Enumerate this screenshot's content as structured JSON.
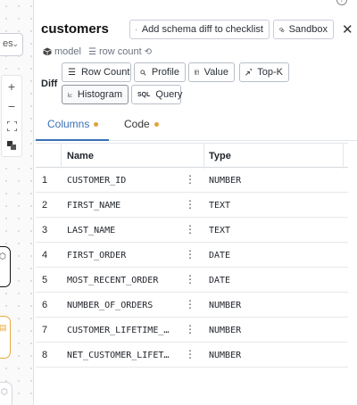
{
  "canvas": {
    "select_value": "es",
    "zoom_controls": [
      "+",
      "−",
      "⛶",
      "◧"
    ]
  },
  "panel": {
    "title": "customers",
    "actions": {
      "schema_diff_label": "Add schema diff to checklist",
      "sandbox_label": "Sandbox"
    },
    "meta": {
      "model_label": "model",
      "row_count_label": "row count"
    },
    "diff": {
      "label": "Diff",
      "buttons": {
        "row_count": "Row Count",
        "profile": "Profile",
        "value": "Value",
        "top_k": "Top-K",
        "histogram": "Histogram",
        "query": "Query"
      }
    },
    "tabs": {
      "columns": "Columns",
      "code": "Code"
    },
    "table": {
      "headers": {
        "name": "Name",
        "type": "Type"
      },
      "rows": [
        {
          "n": "1",
          "name": "CUSTOMER_ID",
          "type": "NUMBER"
        },
        {
          "n": "2",
          "name": "FIRST_NAME",
          "type": "TEXT"
        },
        {
          "n": "3",
          "name": "LAST_NAME",
          "type": "TEXT"
        },
        {
          "n": "4",
          "name": "FIRST_ORDER",
          "type": "DATE"
        },
        {
          "n": "5",
          "name": "MOST_RECENT_ORDER",
          "type": "DATE"
        },
        {
          "n": "6",
          "name": "NUMBER_OF_ORDERS",
          "type": "NUMBER"
        },
        {
          "n": "7",
          "name": "CUSTOMER_LIFETIME_…",
          "type": "NUMBER"
        },
        {
          "n": "8",
          "name": "NET_CUSTOMER_LIFET…",
          "type": "NUMBER"
        }
      ]
    }
  },
  "colors": {
    "accent": "#3b6fb6",
    "changed_dot": "#e0a33a"
  }
}
